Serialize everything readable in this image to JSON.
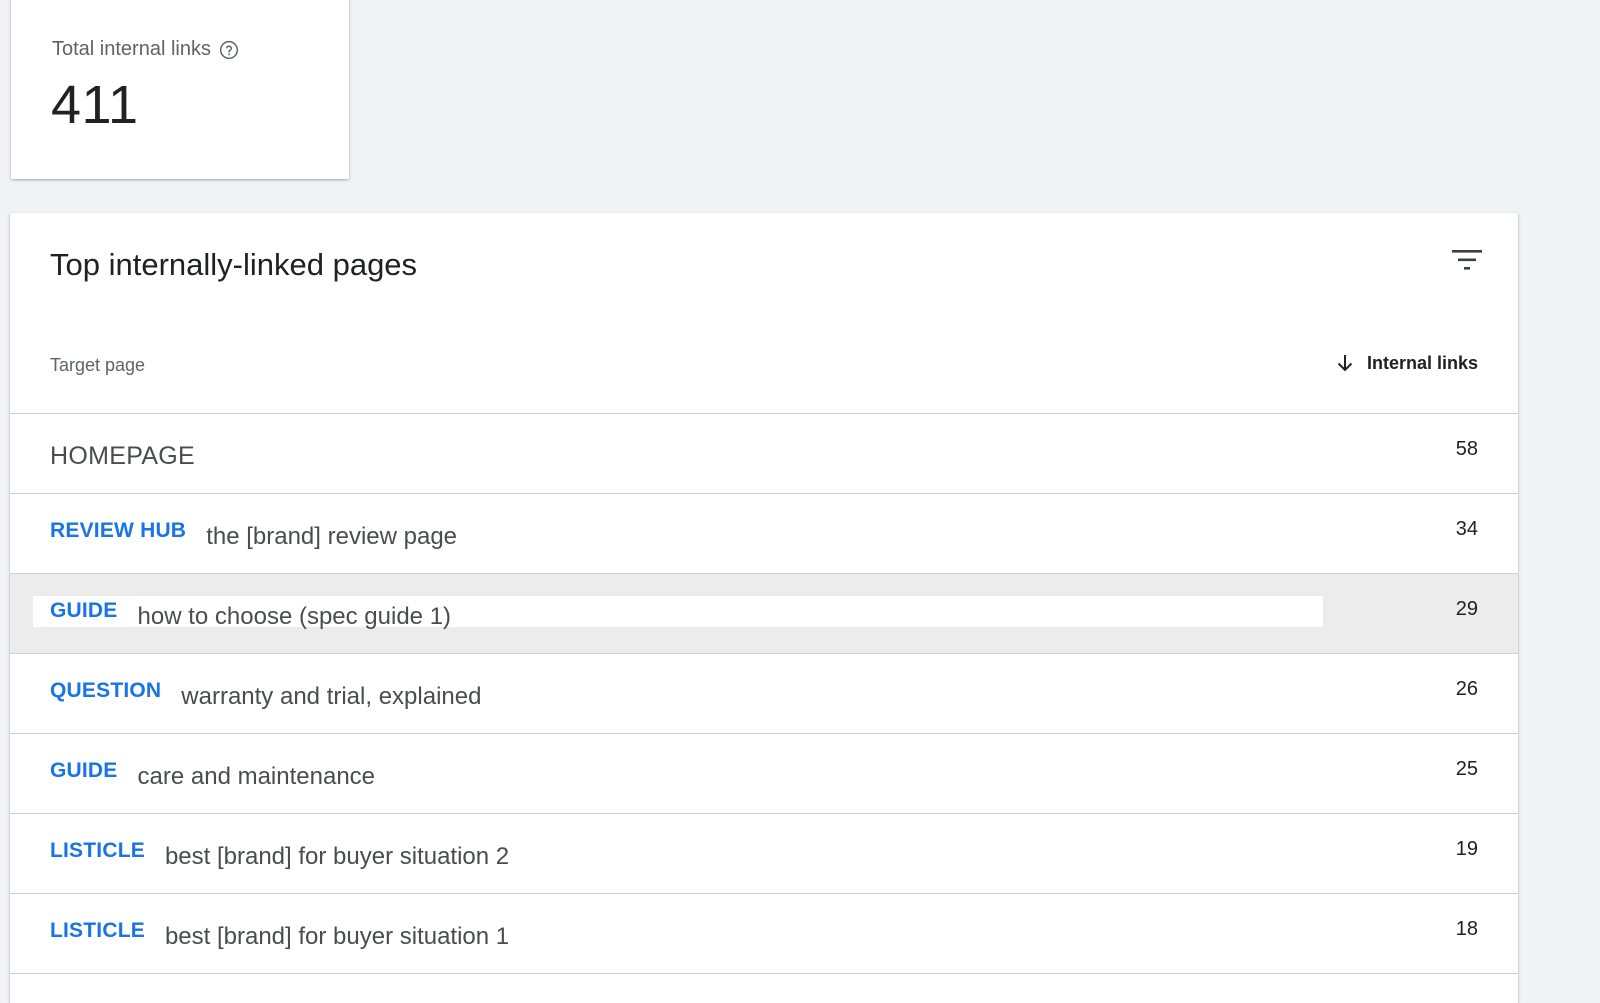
{
  "summary": {
    "label": "Total internal links",
    "help_icon": "help-circle-icon",
    "value": "411"
  },
  "table": {
    "title": "Top internally-linked pages",
    "filter_icon": "filter-icon",
    "columns": {
      "target": "Target page",
      "links": "Internal links",
      "sort_icon": "arrow-down-icon"
    },
    "rows": [
      {
        "badge": "",
        "title": "HOMEPAGE",
        "count": "58"
      },
      {
        "badge": "REVIEW HUB",
        "title": "the [brand] review page",
        "count": "34"
      },
      {
        "badge": "GUIDE",
        "title": "how to choose (spec guide 1)",
        "count": "29",
        "highlighted": true
      },
      {
        "badge": "QUESTION",
        "title": "warranty and trial, explained",
        "count": "26"
      },
      {
        "badge": "GUIDE",
        "title": "care and maintenance",
        "count": "25"
      },
      {
        "badge": "LISTICLE",
        "title": "best [brand] for buyer situation 2",
        "count": "19"
      },
      {
        "badge": "LISTICLE",
        "title": "best [brand] for buyer situation 1",
        "count": "18"
      }
    ]
  },
  "colors": {
    "background": "#f1f3f7",
    "badge_blue": "#1a73e8",
    "divider": "#cfd1d4",
    "highlight_row": "#ececec"
  }
}
